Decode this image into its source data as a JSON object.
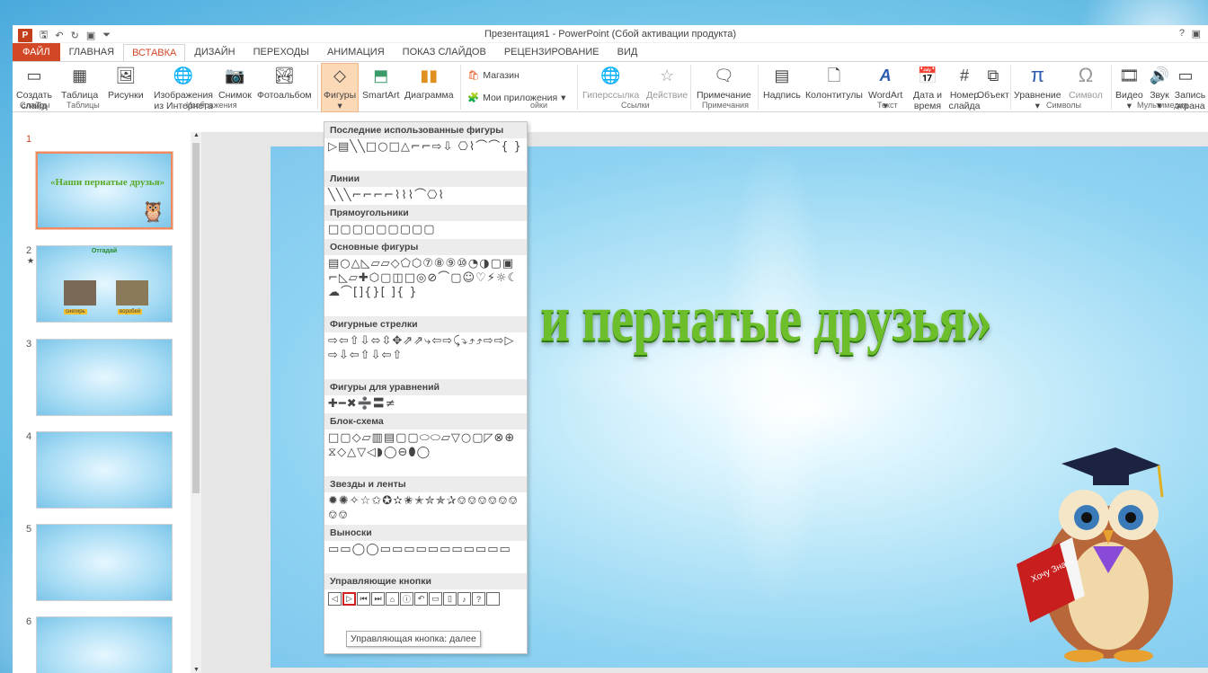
{
  "title": "Презентация1 - PowerPoint (Сбой активации продукта)",
  "help": "?",
  "tabs": [
    "ФАЙЛ",
    "ГЛАВНАЯ",
    "ВСТАВКА",
    "ДИЗАЙН",
    "ПЕРЕХОДЫ",
    "АНИМАЦИЯ",
    "ПОКАЗ СЛАЙДОВ",
    "РЕЦЕНЗИРОВАНИЕ",
    "ВИД"
  ],
  "active_tab": "ВСТАВКА",
  "ribbon": {
    "new_slide": "Создать слайд",
    "table": "Таблица",
    "pictures": "Рисунки",
    "online_pictures": "Изображения из Интернета",
    "screenshot": "Снимок",
    "album": "Фотоальбом",
    "shapes": "Фигуры",
    "smartart": "SmartArt",
    "chart": "Диаграмма",
    "store": "Магазин",
    "my_apps": "Мои приложения",
    "hyperlink": "Гиперссылка",
    "action": "Действие",
    "comment": "Примечание",
    "textbox": "Надпись",
    "header_footer": "Колонтитулы",
    "wordart": "WordArt",
    "date_time": "Дата и время",
    "slide_number": "Номер слайда",
    "object": "Объект",
    "equation": "Уравнение",
    "symbol": "Символ",
    "video": "Видео",
    "audio": "Звук",
    "record": "Запись экрана",
    "groups": {
      "slides": "Слайды",
      "tables": "Таблицы",
      "images": "Изображения",
      "apps": "ойки",
      "links": "Ссылки",
      "comments": "Примечания",
      "text": "Текст",
      "symbols": "Символы",
      "media": "Мультимедиа"
    }
  },
  "shapes_menu": {
    "sections": [
      {
        "title": "Последние использованные фигуры",
        "shapes": "▷▤╲╲□○□△⌐⌐⇨⇩ ⎔⌇⌒⌒{ }"
      },
      {
        "title": "Линии",
        "shapes": "╲╲╲⌐⌐⌐⌐⌇⌇⌇⌒⎔⌇"
      },
      {
        "title": "Прямоугольники",
        "shapes": "□▢▢▢▢▢▢▢▢"
      },
      {
        "title": "Основные фигуры",
        "shapes": "▤○△◺▱▱◇⬠⬡⑦⑧⑨⑩◔◑▢▣⌐◺▱✚⬡▢◫□◎⊘⌒▢☺♡⚡☼☾☁⌒[]{}[ ]{ }"
      },
      {
        "title": "Фигурные стрелки",
        "shapes": "⇨⇦⇧⇩⬄⇳✥⇗⇗⤷⇦⇨⤹⤵⤴⤴⇨⇨▷⇨⇩⇦⇧⇩⇦⇧"
      },
      {
        "title": "Фигуры для уравнений",
        "shapes": "✚━✖➗〓≠"
      },
      {
        "title": "Блок-схема",
        "shapes": "□▢◇▱▥▤▢▢⬭⬭▱▽○▢◸⊗⊕⧖◇△▽◁◗◯⊖⬮◯"
      },
      {
        "title": "Звезды и ленты",
        "shapes": "✹✺✧☆✩✪✫✬✭✮✯✰⎊⎊⎊⎊⎊⎊⎊⎊"
      },
      {
        "title": "Выноски",
        "shapes": "▭▭◯◯▭▭▭▭▭▭▭▭▭▭▭"
      },
      {
        "title": "Управляющие кнопки",
        "shapes": ""
      }
    ],
    "action_buttons": [
      "◁",
      "▷",
      "⏮",
      "⏭",
      "⌂",
      "ⓘ",
      "↶",
      "▭",
      "▯",
      "♪",
      "?",
      " "
    ]
  },
  "tooltip": "Управляющая кнопка: далее",
  "slide_title": "«Наши пернатые друзья»",
  "slide_title_visible": "и пернатые друзья»",
  "thumbs": [
    {
      "num": "1",
      "text": "«Наши пернатые друзья»"
    },
    {
      "num": "2",
      "text": "Отгадай",
      "labels": [
        "снегирь",
        "воробей"
      ]
    },
    {
      "num": "3"
    },
    {
      "num": "4"
    },
    {
      "num": "5"
    },
    {
      "num": "6"
    }
  ],
  "book_text": "Хочу Знать"
}
